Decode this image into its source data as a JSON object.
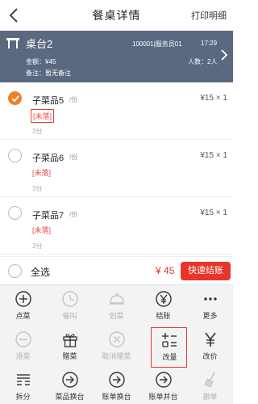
{
  "header": {
    "title": "餐桌详情",
    "print_label": "打印明细"
  },
  "table_card": {
    "name": "桌台2",
    "order_info": "100001|服务员01",
    "time": "17:29",
    "amount": "金额：¥45",
    "people": "人数：2人",
    "remark": "备注：暂无备注"
  },
  "items": [
    {
      "name": "子菜品5",
      "unit": "/份",
      "price": "¥15 × 1",
      "tag": "[未落]",
      "time": "3分",
      "checked": true
    },
    {
      "name": "子菜品6",
      "unit": "/份",
      "price": "¥15 × 1",
      "tag": "[未落]",
      "time": "3分",
      "checked": false
    },
    {
      "name": "子菜品7",
      "unit": "/份",
      "price": "¥15 × 1",
      "tag": "[未落]",
      "time": "3分",
      "checked": false
    }
  ],
  "bottom": {
    "select_all": "全选",
    "total": "¥ 45",
    "checkout": "快速结账"
  },
  "actions": {
    "add": "点菜",
    "urge": "催叫",
    "serve": "划菜",
    "settle": "结账",
    "more": "更多",
    "return": "退菜",
    "gift": "赠菜",
    "cancel_gift": "取消赠菜",
    "change_qty": "改量",
    "change_price": "改价",
    "split": "拆分",
    "change_dish": "菜品换台",
    "bill_change": "账单换台",
    "bill_merge": "账单并台",
    "withdraw": "撤单"
  },
  "colors": {
    "card_bg": "#5a6880",
    "accent_red": "#e8342a",
    "check_orange": "#f0802a"
  }
}
